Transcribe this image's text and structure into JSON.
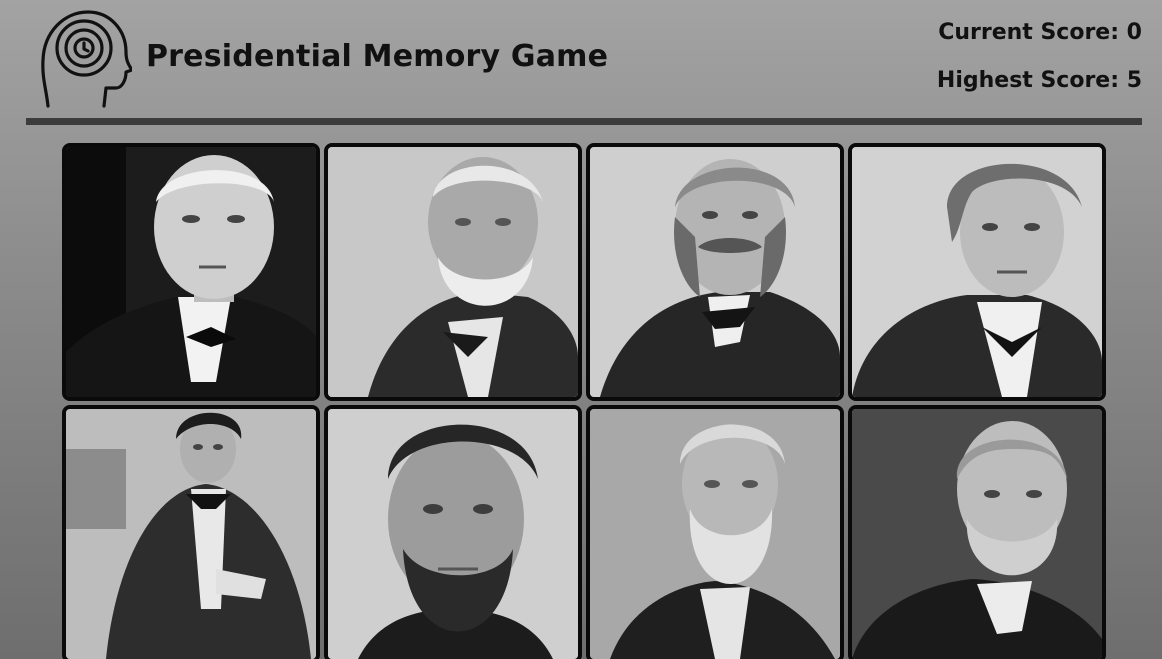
{
  "header": {
    "title": "Presidential Memory Game",
    "logo_icon": "head-with-clock-icon"
  },
  "scores": {
    "current_text": "Current Score: 0",
    "highest_text": "Highest Score: 5",
    "current": 0,
    "highest": 5
  },
  "cards": [
    {
      "id": "card-1",
      "image": "portrait-photo-bald-clean-shaven-man-bow-tie"
    },
    {
      "id": "card-2",
      "image": "portrait-photo-white-bearded-man"
    },
    {
      "id": "card-3",
      "image": "portrait-photo-man-with-mustache-and-sideburns"
    },
    {
      "id": "card-4",
      "image": "portrait-photo-man-with-swept-hair-bow-tie"
    },
    {
      "id": "card-5",
      "image": "portrait-photo-seated-man-curly-hair"
    },
    {
      "id": "card-6",
      "image": "portrait-photo-man-with-chin-beard"
    },
    {
      "id": "card-7",
      "image": "portrait-photo-man-with-long-white-beard"
    },
    {
      "id": "card-8",
      "image": "portrait-photo-balding-man-with-full-beard"
    }
  ]
}
